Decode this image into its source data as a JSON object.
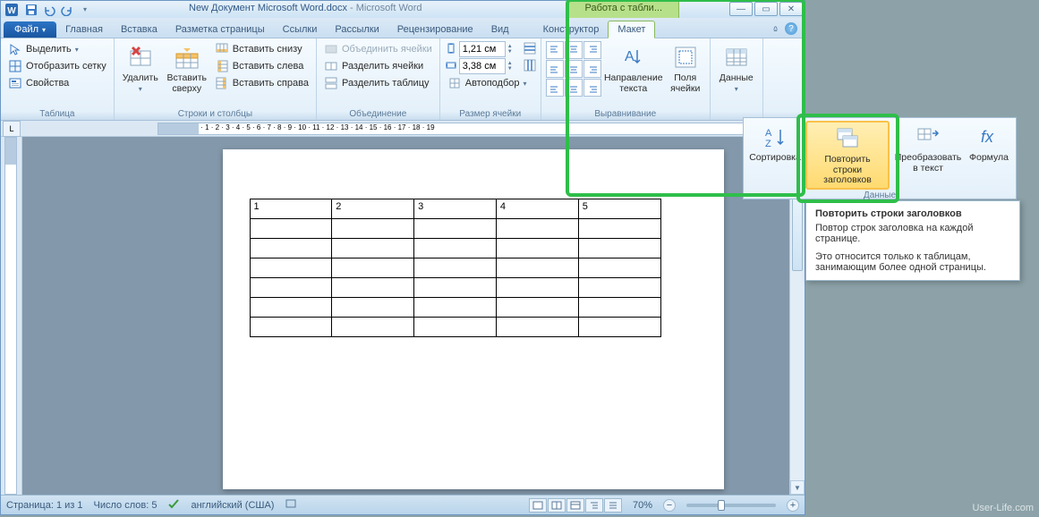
{
  "title": {
    "doc_name": "New Документ Microsoft Word.docx",
    "app_name": "Microsoft Word",
    "context_tab_title": "Работа с табли..."
  },
  "qat": {
    "save": "save",
    "undo": "undo",
    "redo": "redo",
    "more": "▾"
  },
  "winctrl": {
    "min": "—",
    "max": "▭",
    "close": "✕"
  },
  "tabs": {
    "file": "Файл",
    "items": [
      "Главная",
      "Вставка",
      "Разметка страницы",
      "Ссылки",
      "Рассылки",
      "Рецензирование",
      "Вид"
    ],
    "context": [
      "Конструктор",
      "Макет"
    ],
    "minimize": "▴"
  },
  "ribbon": {
    "g1": {
      "title": "Таблица",
      "select": "Выделить",
      "grid": "Отобразить сетку",
      "props": "Свойства"
    },
    "g2": {
      "title": "Строки и столбцы",
      "delete": "Удалить",
      "insert_above": "Вставить сверху",
      "insert_below": "Вставить снизу",
      "insert_left": "Вставить слева",
      "insert_right": "Вставить справа"
    },
    "g3": {
      "title": "Объединение",
      "merge": "Объединить ячейки",
      "split_cells": "Разделить ячейки",
      "split_table": "Разделить таблицу"
    },
    "g4": {
      "title": "Размер ячейки",
      "height": "1,21 см",
      "width": "3,38 см",
      "autofit": "Автоподбор"
    },
    "g5": {
      "title": "Выравнивание",
      "text_dir": "Направление текста",
      "margins": "Поля ячейки"
    },
    "g6": {
      "title": "Данные",
      "data": "Данные"
    }
  },
  "popup": {
    "group_title": "Данные",
    "sort": "Сортировка",
    "repeat_header": "Повторить строки заголовков",
    "convert": "Преобразовать в текст",
    "formula": "Формула"
  },
  "tooltip": {
    "title": "Повторить строки заголовков",
    "line1": "Повтор строк заголовка на каждой странице.",
    "line2": "Это относится только к таблицам, занимающим более одной страницы."
  },
  "table": {
    "headers": [
      "1",
      "2",
      "3",
      "4",
      "5"
    ],
    "body_rows": 6,
    "cols": 5
  },
  "statusbar": {
    "page": "Страница: 1 из 1",
    "words": "Число слов: 5",
    "lang": "английский (США)",
    "zoom_pct": "70%",
    "zoom_minus": "−",
    "zoom_plus": "+"
  },
  "watermark": "User-Life.com"
}
